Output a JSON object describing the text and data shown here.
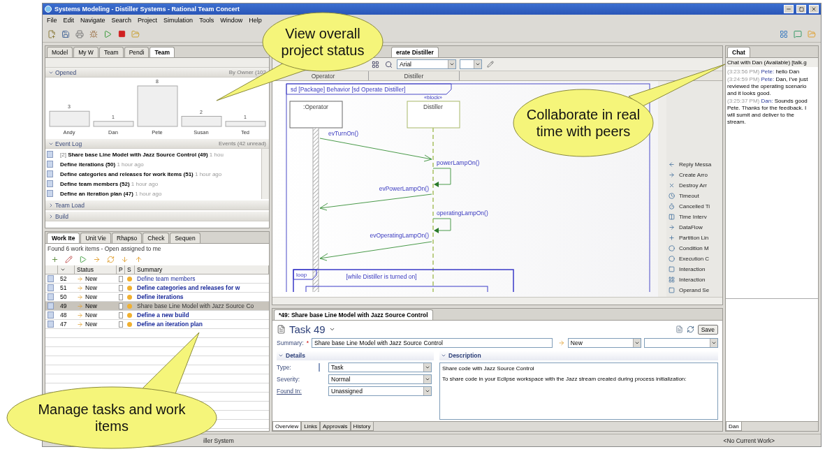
{
  "window": {
    "title": "Systems Modeling - Distiller Systems - Rational Team Concert"
  },
  "menu": [
    "File",
    "Edit",
    "Navigate",
    "Search",
    "Project",
    "Simulation",
    "Tools",
    "Window",
    "Help"
  ],
  "team_view": {
    "tabs": [
      {
        "label": "Model",
        "selected": false
      },
      {
        "label": "My W",
        "selected": false
      },
      {
        "label": "Team",
        "selected": false
      },
      {
        "label": "Pendi",
        "selected": false
      },
      {
        "label": "Team",
        "selected": true
      }
    ],
    "sections": [
      {
        "kind": "chart",
        "title": "Opened",
        "expanded": true,
        "info": "By Owner (102",
        "chart_data": {
          "type": "bar",
          "categories": [
            "Andy",
            "Dan",
            "Pete",
            "Susan",
            "Ted"
          ],
          "values": [
            3,
            1,
            8,
            2,
            1
          ],
          "data_labels": true
        }
      },
      {
        "kind": "log",
        "title": "Event Log",
        "expanded": true,
        "info": "Events (42 unread)",
        "rows": [
          {
            "prefix": "[2]",
            "title": "Share base Line Model with Jazz Source Control (49)",
            "time": "1 hou"
          },
          {
            "prefix": "",
            "title": "Define iterations (50)",
            "time": "1 hour ago"
          },
          {
            "prefix": "",
            "title": "Define categories and releases for work items (51)",
            "time": "1 hour ago"
          },
          {
            "prefix": "",
            "title": "Define team members (52)",
            "time": "1 hour ago"
          },
          {
            "prefix": "",
            "title": "Define an iteration plan (47)",
            "time": "1 hour ago"
          }
        ]
      },
      {
        "kind": "plain",
        "title": "Team Load",
        "expanded": false
      },
      {
        "kind": "plain",
        "title": "Build",
        "expanded": false
      }
    ]
  },
  "work_items": {
    "tabs": [
      {
        "label": "Work Ite",
        "selected": true
      },
      {
        "label": "Unit Vie",
        "selected": false
      },
      {
        "label": "Rhapso",
        "selected": false
      },
      {
        "label": "Check",
        "selected": false
      },
      {
        "label": "Sequen",
        "selected": false
      }
    ],
    "status": "Found 6 work items - Open assigned to me",
    "columns": [
      "Status",
      "P",
      "S",
      "Summary"
    ],
    "rows": [
      {
        "id": "52",
        "status": "New",
        "summary": "Define team members",
        "unread": false,
        "selected": false
      },
      {
        "id": "51",
        "status": "New",
        "summary": "Define categories and releases for w",
        "unread": true,
        "selected": false
      },
      {
        "id": "50",
        "status": "New",
        "summary": "Define iterations",
        "unread": true,
        "selected": false
      },
      {
        "id": "49",
        "status": "New",
        "summary": "Share base Line Model with Jazz Source Co",
        "unread": false,
        "selected": true
      },
      {
        "id": "48",
        "status": "New",
        "summary": "Define a new build",
        "unread": true,
        "selected": false
      },
      {
        "id": "47",
        "status": "New",
        "summary": "Define an iteration plan",
        "unread": true,
        "selected": false
      }
    ]
  },
  "diagram_editor": {
    "tab": "erate Distiller",
    "font": "Arial",
    "lanes": [
      "Operator",
      "Distiller"
    ],
    "frame_label": "sd [Package] Behavior [sd Operate Distiller]",
    "lifelines": [
      {
        "name": ":Operator"
      },
      {
        "stereotype": "«block»",
        "name": "Distiller"
      }
    ],
    "messages": [
      {
        "kind": "send",
        "label": "evTurnOn()"
      },
      {
        "kind": "self",
        "label": "powerLampOn()"
      },
      {
        "kind": "reply",
        "label": "evPowerLampOn()"
      },
      {
        "kind": "self",
        "label": "operatingLampOn()"
      },
      {
        "kind": "reply",
        "label": "evOperatingLampOn()"
      }
    ],
    "loop": {
      "label": "loop",
      "guard": "[while Distiller is turned on]"
    },
    "palette": [
      "Reply Messa",
      "Create Arro",
      "Destroy Arr",
      "Timeout",
      "Cancelled Ti",
      "Time Interv",
      "DataFlow",
      "Partition Lin",
      "Condition M",
      "Execution C",
      "Interaction",
      "Interaction",
      "Operand Se"
    ]
  },
  "task_editor": {
    "tab": "*49: Share base Line Model with Jazz Source Control",
    "title": "Task 49",
    "save": "Save",
    "summary_label": "Summary:",
    "required_mark": "*",
    "summary": "Share base Line Model with Jazz Source Control",
    "state": "New",
    "details": {
      "title": "Details",
      "fields": [
        {
          "label": "Type:",
          "value": "Task",
          "link": false
        },
        {
          "label": "Severity:",
          "value": "Normal",
          "link": false
        },
        {
          "label": "Found In:",
          "value": "Unassigned",
          "link": true
        }
      ]
    },
    "description": {
      "title": "Description",
      "lines": [
        "Share code with Jazz Source Control",
        "To share code in your Eclipse workspace with the Jazz stream created during process initialization:"
      ]
    },
    "tabs": [
      {
        "label": "Overview",
        "selected": true
      },
      {
        "label": "Links",
        "selected": false
      },
      {
        "label": "Approvals",
        "selected": false
      },
      {
        "label": "History",
        "selected": false
      }
    ]
  },
  "chat": {
    "tab": "Chat",
    "header": "Chat with Dan (Available) [talk.g",
    "messages": [
      {
        "time": "(3:23:56 PM)",
        "sender": "Pete:",
        "text": "hello Dan"
      },
      {
        "time": "(3:24:59 PM)",
        "sender": "Pete:",
        "text": "Dan, I've just reviewed the operating scenario and it looks good."
      },
      {
        "time": "(3:25:37 PM)",
        "sender": "Dan:",
        "text": "Sounds good Pete. Thanks for the feedback. I will sumit and deliver to the stream."
      }
    ],
    "bottom_tab": "Dan"
  },
  "status_bar": {
    "left": "iller System",
    "right": "<No Current Work>"
  },
  "callouts": [
    "View overall project status",
    "Collaborate in real time with peers",
    "Manage tasks and work items"
  ]
}
